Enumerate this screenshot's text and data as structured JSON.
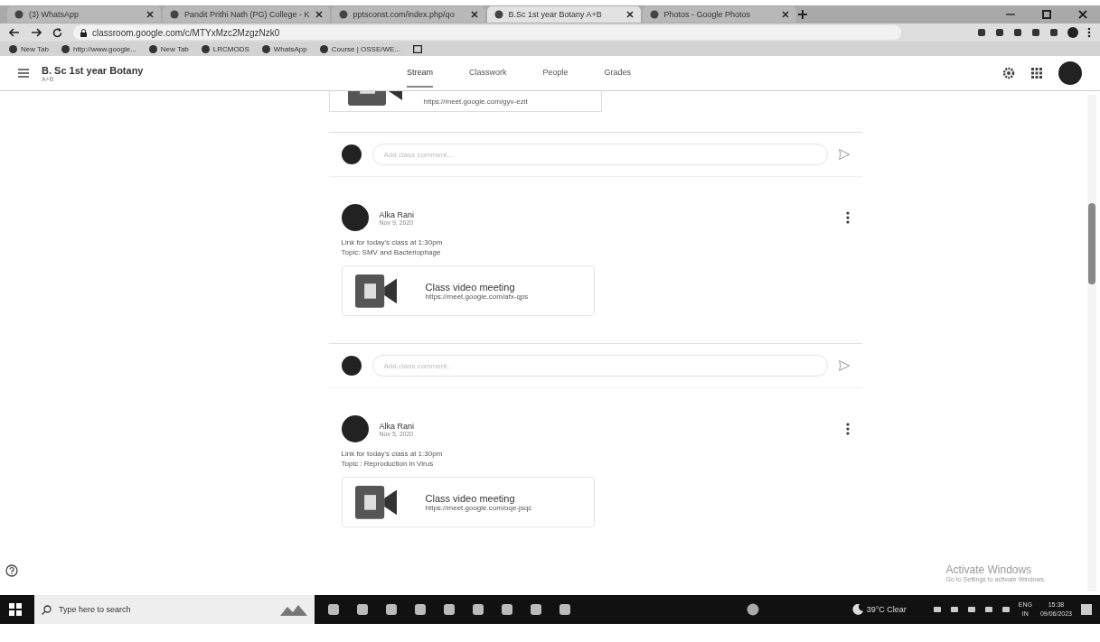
{
  "browser": {
    "tabs": [
      {
        "label": "(3) WhatsApp",
        "selected": false
      },
      {
        "label": "Pandit Prithi Nath (PG) College - K",
        "selected": false
      },
      {
        "label": "pptsconst.com/index.php/qo",
        "selected": false
      },
      {
        "label": "B.Sc 1st year Botany A+B",
        "selected": true
      },
      {
        "label": "Photos - Google Photos",
        "selected": false
      }
    ],
    "address": "classroom.google.com/c/MTYxMzc2MzgzNzk0",
    "bookmarks": [
      "New Tab",
      "http://www.google...",
      "New Tab",
      "LRCMODS",
      "WhatsApp",
      "Course | OSSE/WE..."
    ]
  },
  "class_header": {
    "title": "B. Sc 1st year Botany",
    "section": "A+B",
    "tabs": [
      {
        "label": "Stream",
        "selected": true
      },
      {
        "label": "Classwork",
        "selected": false
      },
      {
        "label": "People",
        "selected": false
      },
      {
        "label": "Grades",
        "selected": false
      }
    ]
  },
  "stream": {
    "top_card_link": "https://meet.google.com/gyv-ezit",
    "posts": [
      {
        "comment_placeholder": "Add class comment...",
        "author": "Alka Rani",
        "date": "Nov 9, 2020",
        "lines": [
          "Link for today's class at 1:30pm",
          "Topic: SMV and Bacteriophage"
        ],
        "attachment": {
          "title": "Class video meeting",
          "link": "https://meet.google.com/afx-qps"
        }
      },
      {
        "comment_placeholder": "Add class comment...",
        "author": "Alka Rani",
        "date": "Nov 5, 2020",
        "lines": [
          "Link for today's class at 1:30pm",
          "Topic : Reproduction in Virus"
        ],
        "attachment": {
          "title": "Class video meeting",
          "link": "https://meet.google.com/oqe-jsqc"
        }
      }
    ]
  },
  "activation_notice": {
    "title": "Activate Windows",
    "text": "Go to Settings to activate Windows."
  },
  "taskbar": {
    "search_placeholder": "Type here to search",
    "weather": "39°C Clear",
    "language": "ENG",
    "region": "IN",
    "time": "15:38",
    "date": "09/06/2023"
  }
}
